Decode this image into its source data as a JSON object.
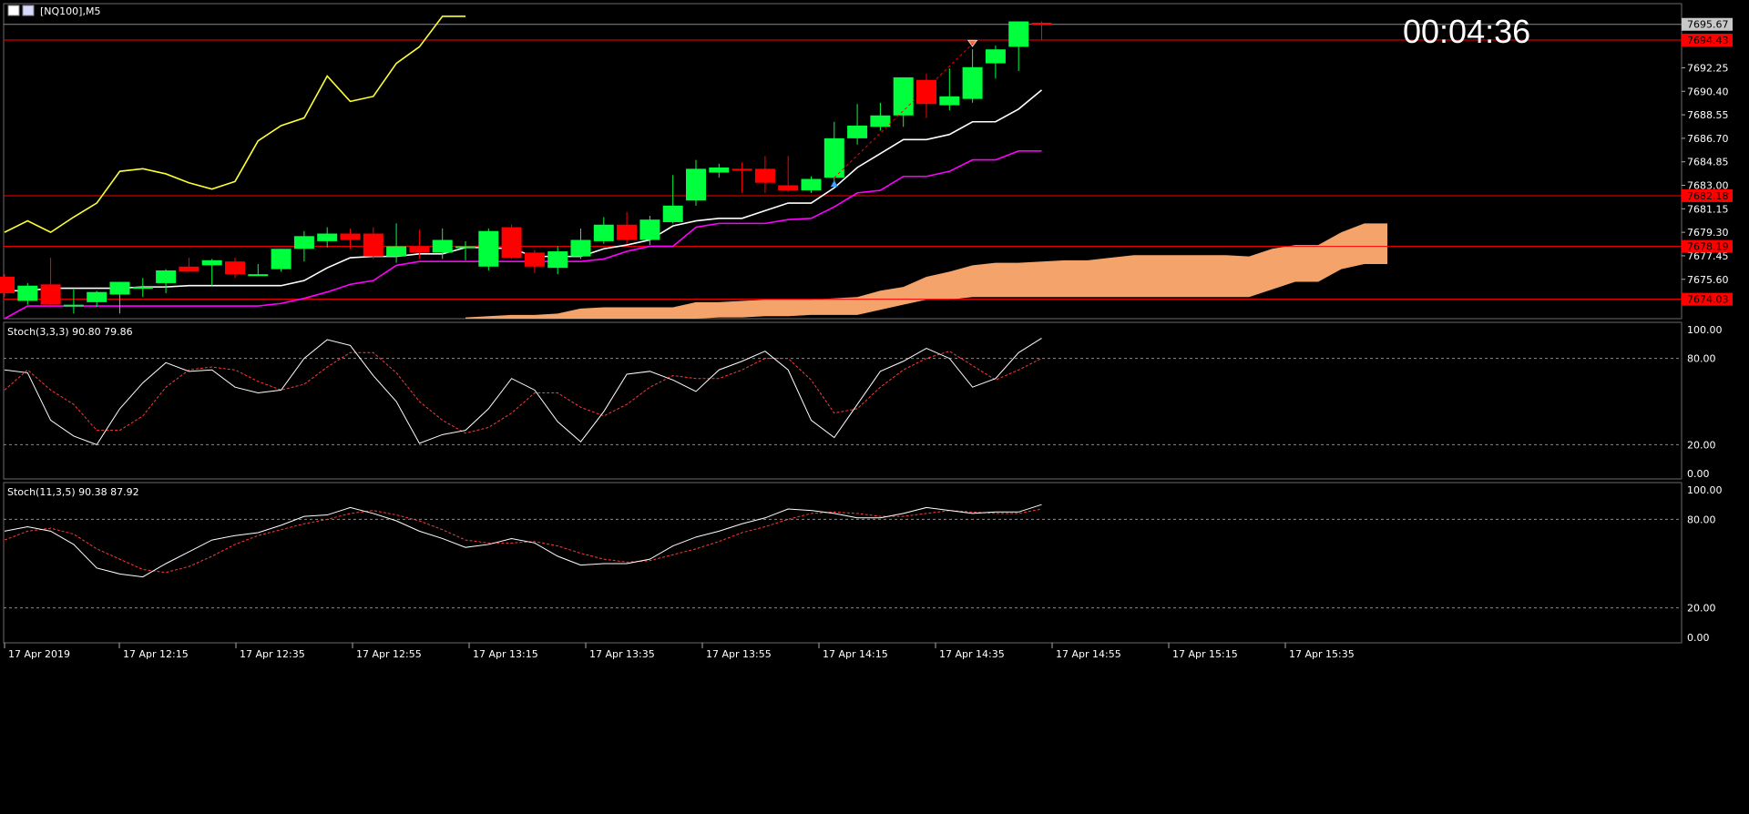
{
  "symbol_label": "[NQ100],M5",
  "countdown": "00:04:36",
  "colors": {
    "background": "#000000",
    "grid": "#2f2f2f",
    "axis_text": "#ffffff",
    "bull": "#00ff3c",
    "bear": "#ff0000",
    "hline": "#ff0000",
    "ichimoku_fast": "#ffffff",
    "ichimoku_slow": "#ff00ff",
    "chikou": "#ffff33",
    "cloud": "#f4a46a",
    "stoch_main": "#ffffff",
    "stoch_signal": "#ff3a3a"
  },
  "chart_data": [
    {
      "type": "candlestick",
      "title": "[NQ100],M5",
      "y_ticks": [
        7692.25,
        7690.4,
        7688.55,
        7686.7,
        7684.85,
        7683.0,
        7681.15,
        7679.3,
        7677.45,
        7675.6
      ],
      "ylim": [
        7672.5,
        7697.3
      ],
      "current_price": 7695.67,
      "horizontal_lines": [
        7694.43,
        7682.18,
        7678.19,
        7674.03
      ],
      "x_labels": [
        "17 Apr 2019",
        "17 Apr 12:15",
        "17 Apr 12:35",
        "17 Apr 12:55",
        "17 Apr 13:15",
        "17 Apr 13:35",
        "17 Apr 13:55",
        "17 Apr 14:15",
        "17 Apr 14:35",
        "17 Apr 14:55",
        "17 Apr 15:15",
        "17 Apr 15:35"
      ],
      "candles": [
        {
          "o": 7675.8,
          "h": 7676.0,
          "l": 7674.2,
          "c": 7674.5
        },
        {
          "o": 7673.9,
          "h": 7675.3,
          "l": 7673.6,
          "c": 7675.1
        },
        {
          "o": 7675.2,
          "h": 7677.3,
          "l": 7673.4,
          "c": 7673.6
        },
        {
          "o": 7673.6,
          "h": 7674.8,
          "l": 7672.9,
          "c": 7673.6
        },
        {
          "o": 7673.8,
          "h": 7674.7,
          "l": 7673.4,
          "c": 7674.6
        },
        {
          "o": 7674.4,
          "h": 7675.4,
          "l": 7672.9,
          "c": 7675.4
        },
        {
          "o": 7675.0,
          "h": 7675.7,
          "l": 7674.2,
          "c": 7675.0
        },
        {
          "o": 7675.3,
          "h": 7676.4,
          "l": 7674.5,
          "c": 7676.3
        },
        {
          "o": 7676.6,
          "h": 7677.3,
          "l": 7676.2,
          "c": 7676.2
        },
        {
          "o": 7676.7,
          "h": 7677.2,
          "l": 7675.1,
          "c": 7677.1
        },
        {
          "o": 7677.0,
          "h": 7677.3,
          "l": 7675.7,
          "c": 7676.0
        },
        {
          "o": 7676.0,
          "h": 7676.8,
          "l": 7675.9,
          "c": 7676.0
        },
        {
          "o": 7676.4,
          "h": 7678.0,
          "l": 7676.2,
          "c": 7678.0
        },
        {
          "o": 7678.0,
          "h": 7679.4,
          "l": 7677.0,
          "c": 7679.0
        },
        {
          "o": 7678.6,
          "h": 7679.7,
          "l": 7678.1,
          "c": 7679.2
        },
        {
          "o": 7679.2,
          "h": 7679.6,
          "l": 7678.0,
          "c": 7678.7
        },
        {
          "o": 7679.2,
          "h": 7679.7,
          "l": 7677.2,
          "c": 7677.4
        },
        {
          "o": 7677.4,
          "h": 7680.0,
          "l": 7676.9,
          "c": 7678.2
        },
        {
          "o": 7678.2,
          "h": 7679.5,
          "l": 7677.2,
          "c": 7677.7
        },
        {
          "o": 7677.7,
          "h": 7679.6,
          "l": 7677.2,
          "c": 7678.7
        },
        {
          "o": 7678.2,
          "h": 7678.6,
          "l": 7677.1,
          "c": 7678.2
        },
        {
          "o": 7676.6,
          "h": 7679.6,
          "l": 7676.3,
          "c": 7679.4
        },
        {
          "o": 7679.7,
          "h": 7679.9,
          "l": 7677.2,
          "c": 7677.3
        },
        {
          "o": 7677.7,
          "h": 7677.9,
          "l": 7676.1,
          "c": 7676.6
        },
        {
          "o": 7676.5,
          "h": 7678.2,
          "l": 7676.0,
          "c": 7677.8
        },
        {
          "o": 7677.4,
          "h": 7679.6,
          "l": 7677.2,
          "c": 7678.7
        },
        {
          "o": 7678.6,
          "h": 7680.5,
          "l": 7678.4,
          "c": 7679.9
        },
        {
          "o": 7679.9,
          "h": 7680.9,
          "l": 7678.4,
          "c": 7678.7
        },
        {
          "o": 7678.7,
          "h": 7680.6,
          "l": 7678.3,
          "c": 7680.3
        },
        {
          "o": 7680.1,
          "h": 7683.8,
          "l": 7680.0,
          "c": 7681.4
        },
        {
          "o": 7681.8,
          "h": 7685.0,
          "l": 7681.4,
          "c": 7684.3
        },
        {
          "o": 7684.0,
          "h": 7684.7,
          "l": 7683.6,
          "c": 7684.4
        },
        {
          "o": 7684.3,
          "h": 7684.8,
          "l": 7682.4,
          "c": 7684.2
        },
        {
          "o": 7684.3,
          "h": 7685.3,
          "l": 7682.4,
          "c": 7683.2
        },
        {
          "o": 7683.0,
          "h": 7685.3,
          "l": 7682.5,
          "c": 7682.6
        },
        {
          "o": 7682.6,
          "h": 7683.7,
          "l": 7682.4,
          "c": 7683.5
        },
        {
          "o": 7683.6,
          "h": 7688.0,
          "l": 7683.1,
          "c": 7686.7
        },
        {
          "o": 7686.7,
          "h": 7689.4,
          "l": 7686.2,
          "c": 7687.7
        },
        {
          "o": 7687.6,
          "h": 7689.5,
          "l": 7687.3,
          "c": 7688.5
        },
        {
          "o": 7688.5,
          "h": 7691.5,
          "l": 7687.6,
          "c": 7691.5
        },
        {
          "o": 7691.3,
          "h": 7691.8,
          "l": 7688.3,
          "c": 7689.4
        },
        {
          "o": 7689.3,
          "h": 7692.2,
          "l": 7688.9,
          "c": 7690.0
        },
        {
          "o": 7689.8,
          "h": 7693.7,
          "l": 7689.5,
          "c": 7692.3
        },
        {
          "o": 7692.6,
          "h": 7694.0,
          "l": 7691.4,
          "c": 7693.7
        },
        {
          "o": 7693.9,
          "h": 7695.9,
          "l": 7692.0,
          "c": 7695.9
        },
        {
          "o": 7695.8,
          "h": 7695.9,
          "l": 7694.4,
          "c": 7695.7
        }
      ],
      "series": [
        {
          "kind": "ichimoku-fast",
          "color": "#ffffff",
          "values": [
            7674.7,
            7674.7,
            7674.9,
            7674.9,
            7674.9,
            7674.9,
            7675.0,
            7675.0,
            7675.1,
            7675.1,
            7675.1,
            7675.1,
            7675.1,
            7675.5,
            7676.5,
            7677.3,
            7677.4,
            7677.4,
            7677.6,
            7677.6,
            7678.1,
            7678.1,
            7678.0,
            7677.4,
            7677.4,
            7677.4,
            7678.0,
            7678.3,
            7678.7,
            7679.8,
            7680.2,
            7680.4,
            7680.4,
            7681.0,
            7681.6,
            7681.6,
            7682.8,
            7684.4,
            7685.5,
            7686.6,
            7686.6,
            7687.0,
            7688.0,
            7688.0,
            7689.0,
            7690.5
          ]
        },
        {
          "kind": "ichimoku-slow",
          "color": "#ff00ff",
          "values": [
            7672.5,
            7673.5,
            7673.5,
            7673.5,
            7673.5,
            7673.5,
            7673.5,
            7673.5,
            7673.5,
            7673.5,
            7673.5,
            7673.5,
            7673.7,
            7674.1,
            7674.6,
            7675.2,
            7675.5,
            7676.7,
            7677.0,
            7677.0,
            7677.0,
            7677.0,
            7677.0,
            7677.0,
            7677.0,
            7677.0,
            7677.2,
            7677.8,
            7678.2,
            7678.2,
            7679.7,
            7680.0,
            7680.0,
            7680.0,
            7680.3,
            7680.4,
            7681.3,
            7682.4,
            7682.6,
            7683.7,
            7683.7,
            7684.1,
            7685.0,
            7685.0,
            7685.7,
            7685.7
          ]
        },
        {
          "kind": "chikou",
          "color": "#ffff33",
          "values": [
            7679.3,
            7680.2,
            7679.3,
            7680.5,
            7681.6,
            7684.1,
            7684.3,
            7683.9,
            7683.2,
            7682.7,
            7683.3,
            7686.5,
            7687.7,
            7688.3,
            7691.6,
            7689.6,
            7690.0,
            7692.6,
            7693.9,
            7696.3,
            7696.3
          ]
        }
      ],
      "cloud": {
        "start_index": 20,
        "upper": [
          7672.6,
          7672.7,
          7672.8,
          7672.8,
          7672.9,
          7673.3,
          7673.4,
          7673.4,
          7673.4,
          7673.4,
          7673.8,
          7673.8,
          7673.9,
          7674.0,
          7674.0,
          7674.0,
          7674.1,
          7674.2,
          7674.7,
          7675.0,
          7675.8,
          7676.2,
          7676.7,
          7676.9,
          7676.9,
          7677.0,
          7677.1,
          7677.1,
          7677.3,
          7677.5,
          7677.5,
          7677.5,
          7677.5,
          7677.5,
          7677.4,
          7678.0,
          7678.3,
          7678.3,
          7679.3,
          7680.0,
          7680.0
        ],
        "lower": [
          7672.5,
          7672.5,
          7672.5,
          7672.5,
          7672.5,
          7672.5,
          7672.5,
          7672.5,
          7672.5,
          7672.5,
          7672.5,
          7672.6,
          7672.6,
          7672.7,
          7672.7,
          7672.8,
          7672.8,
          7672.8,
          7673.2,
          7673.6,
          7674.0,
          7674.0,
          7674.2,
          7674.2,
          7674.2,
          7674.2,
          7674.2,
          7674.2,
          7674.2,
          7674.2,
          7674.2,
          7674.2,
          7674.2,
          7674.2,
          7674.2,
          7674.8,
          7675.4,
          7675.4,
          7676.4,
          7676.8,
          7676.8
        ]
      },
      "markers": [
        {
          "kind": "buy-arrow",
          "index": 36
        },
        {
          "kind": "sell-arrow",
          "index": 42
        }
      ]
    },
    {
      "type": "line",
      "title": "Stoch(3,3,3) 90.80 79.86",
      "ylim": [
        0,
        100
      ],
      "y_ticks": [
        100.0,
        80.0,
        20.0,
        0.0
      ],
      "levels": [
        80,
        20
      ],
      "series": [
        {
          "name": "main",
          "values": [
            72,
            70,
            37,
            26,
            20,
            45,
            63,
            77,
            71,
            72,
            60,
            56,
            58,
            80,
            93,
            89,
            68,
            50,
            21,
            27,
            30,
            45,
            66,
            58,
            36,
            22,
            43,
            69,
            71,
            65,
            57,
            72,
            78,
            85,
            72,
            37,
            25,
            48,
            71,
            78,
            87,
            80,
            60,
            66,
            84,
            94
          ]
        },
        {
          "name": "signal",
          "values": [
            58,
            72,
            58,
            48,
            30,
            30,
            40,
            60,
            72,
            74,
            72,
            64,
            58,
            62,
            74,
            84,
            84,
            70,
            50,
            37,
            28,
            32,
            42,
            56,
            56,
            46,
            40,
            48,
            60,
            68,
            66,
            66,
            72,
            80,
            80,
            65,
            42,
            45,
            60,
            72,
            80,
            85,
            75,
            65,
            72,
            80
          ]
        }
      ]
    },
    {
      "type": "line",
      "title": "Stoch(11,3,5) 90.38 87.92",
      "ylim": [
        0,
        100
      ],
      "y_ticks": [
        100.0,
        80.0,
        20.0,
        0.0
      ],
      "levels": [
        80,
        20
      ],
      "series": [
        {
          "name": "main",
          "values": [
            72,
            75,
            72,
            63,
            47,
            43,
            41,
            50,
            58,
            66,
            69,
            71,
            76,
            82,
            83,
            88,
            84,
            79,
            72,
            67,
            61,
            63,
            67,
            64,
            55,
            49,
            50,
            50,
            53,
            62,
            68,
            72,
            77,
            81,
            87,
            86,
            84,
            81,
            81,
            84,
            88,
            86,
            84,
            85,
            85,
            90
          ]
        },
        {
          "name": "signal",
          "values": [
            66,
            72,
            74,
            70,
            60,
            53,
            46,
            44,
            48,
            55,
            63,
            69,
            73,
            77,
            80,
            84,
            86,
            83,
            79,
            73,
            66,
            64,
            64,
            65,
            62,
            57,
            53,
            51,
            52,
            56,
            60,
            65,
            71,
            75,
            80,
            84,
            85,
            84,
            82,
            82,
            84,
            86,
            85,
            84,
            84,
            87
          ]
        }
      ]
    }
  ]
}
